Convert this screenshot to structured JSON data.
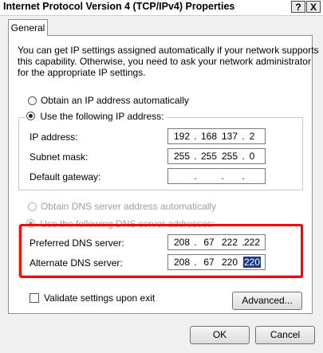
{
  "window": {
    "title": "Internet Protocol Version 4 (TCP/IPv4) Properties",
    "help_button": "?",
    "close_button": "X"
  },
  "tabs": [
    {
      "label": "General",
      "selected": true
    }
  ],
  "description": {
    "lines": [
      "You can get IP settings assigned automatically if your network supports",
      "this capability. Otherwise, you need to ask your network administrator",
      "for the appropriate IP settings."
    ]
  },
  "ip_section": {
    "auto_option": {
      "label": "Obtain an IP address automatically",
      "selected": false
    },
    "manual_option": {
      "label": "Use the following IP address:",
      "selected": true
    },
    "fields": [
      {
        "label": "IP address:",
        "octets": [
          "192",
          "168",
          "137",
          "2"
        ]
      },
      {
        "label": "Subnet mask:",
        "octets": [
          "255",
          "255",
          "255",
          "0"
        ]
      },
      {
        "label": "Default gateway:",
        "octets": [
          "",
          "",
          "",
          ""
        ]
      }
    ]
  },
  "dns_section": {
    "auto_option": {
      "label": "Obtain DNS server address automatically",
      "selected": false,
      "enabled": false
    },
    "manual_option": {
      "label": "Use the following DNS server addresses:",
      "selected": true,
      "enabled": false
    },
    "fields": [
      {
        "label": "Preferred DNS server:",
        "octets": [
          "208",
          "67",
          "222",
          "222"
        ]
      },
      {
        "label": "Alternate DNS server:",
        "octets": [
          "208",
          "67",
          "220",
          "220"
        ],
        "selected_octet": 3
      }
    ]
  },
  "validate_checkbox": {
    "label": "Validate settings upon exit",
    "checked": false
  },
  "buttons": {
    "advanced": "Advanced...",
    "ok": "OK",
    "cancel": "Cancel"
  },
  "colors": {
    "highlight_box": "#ff0000",
    "selection": "#1a3a8a"
  }
}
